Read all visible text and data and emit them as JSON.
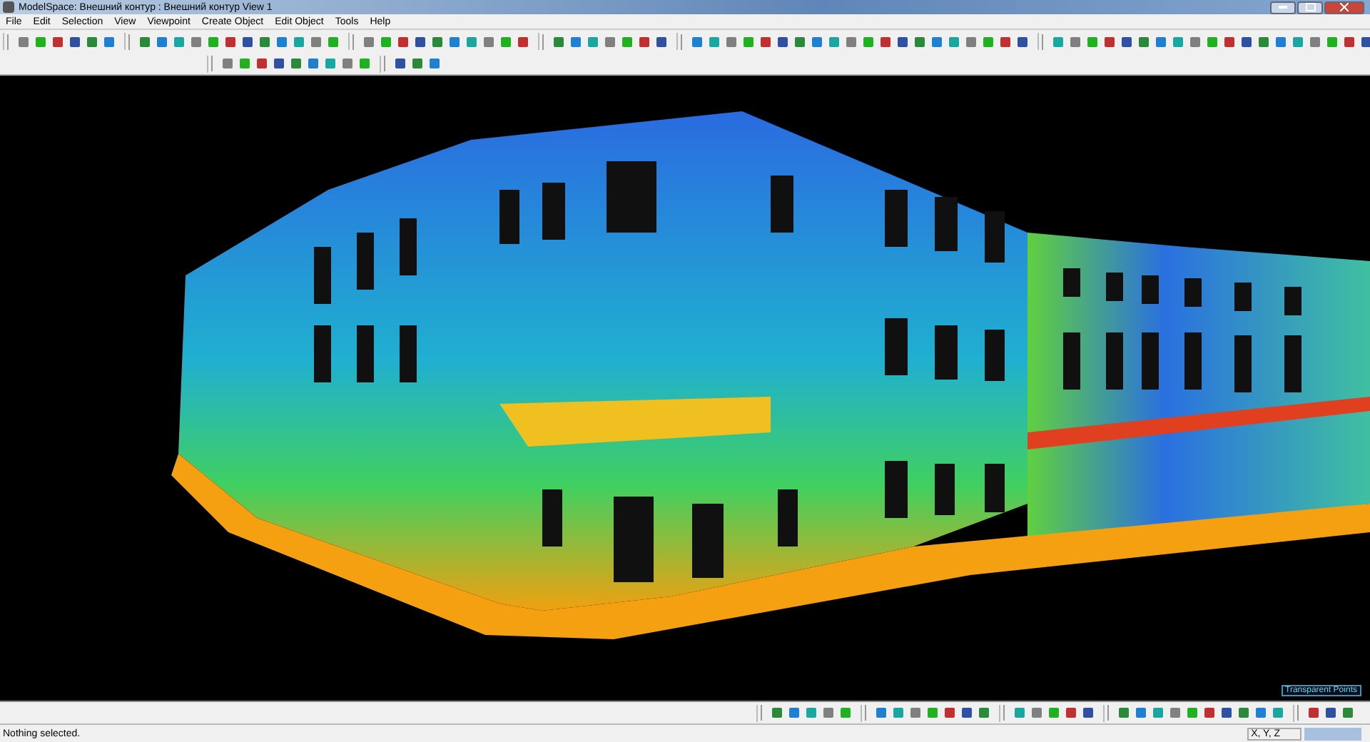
{
  "window": {
    "title": "ModelSpace: Внешний контур : Внешний контур View 1"
  },
  "menu": [
    "File",
    "Edit",
    "Selection",
    "View",
    "Viewpoint",
    "Create Object",
    "Edit Object",
    "Tools",
    "Help"
  ],
  "viewport": {
    "badge": "Transparent Points"
  },
  "status_bar": {
    "message": "Nothing selected.",
    "coordinates": "X, Y, Z"
  }
}
